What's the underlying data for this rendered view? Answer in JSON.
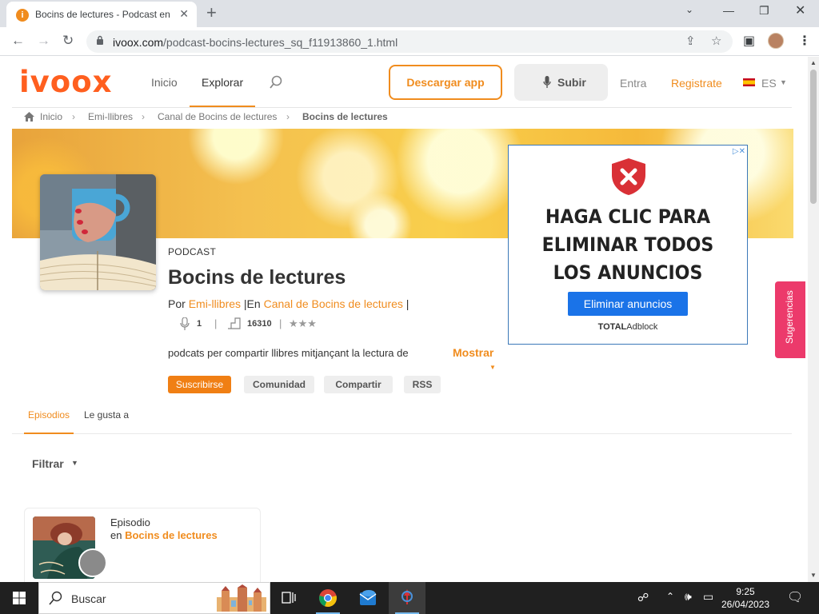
{
  "browser": {
    "tab_title": "Bocins de lectures - Podcast en iVoox",
    "tab_favicon_letter": "i",
    "new_tab": "+",
    "url_host": "ivoox.com",
    "url_path": "/podcast-bocins-lectures_sq_f11913860_1.html"
  },
  "header": {
    "logo_text": "ivoox",
    "nav": [
      "Inicio",
      "Explorar"
    ],
    "download_app": "Descargar app",
    "upload": "Subir",
    "login": "Entra",
    "register": "Registrate",
    "language": "ES"
  },
  "breadcrumb": [
    "Inicio",
    "Emi-llibres",
    "Canal de Bocins de lectures",
    "Bocins de lectures"
  ],
  "podcast": {
    "tag": "PODCAST",
    "title": "Bocins de lectures",
    "by_prefix": "Por",
    "author": "Emi-llibres",
    "channel_prefix": "|En",
    "channel": "Canal de Bocins de lectures",
    "channel_suffix": "|",
    "episodes_count": "1",
    "plays": "16310",
    "stars": "★★★",
    "description": "podcats per compartir llibres mitjançant la lectura de",
    "show_more": "Mostrar",
    "buttons": {
      "subscribe": "Suscribirse",
      "community": "Comunidad",
      "share": "Compartir",
      "rss": "RSS"
    }
  },
  "ad": {
    "headline_lines": [
      "HAGA CLIC PARA",
      "ELIMINAR TODOS",
      "LOS ANUNCIOS"
    ],
    "button": "Eliminar anuncios",
    "brand_bold": "TOTAL",
    "brand_rest": "Adblock",
    "adchoices": "▷✕"
  },
  "side_tab": "Sugerencias",
  "tabs": [
    "Episodios",
    "Le gusta a"
  ],
  "filter_label": "Filtrar",
  "episode_card": {
    "type_label": "Episodio",
    "in_prefix": "en",
    "podcast_name": "Bocins de lectures"
  },
  "taskbar": {
    "search_placeholder": "Buscar",
    "time": "9:25",
    "date": "26/04/2023"
  },
  "colors": {
    "brand_orange": "#f08c1e",
    "ad_blue": "#1a73e8",
    "sugerencias_pink": "#ec3a6b"
  }
}
